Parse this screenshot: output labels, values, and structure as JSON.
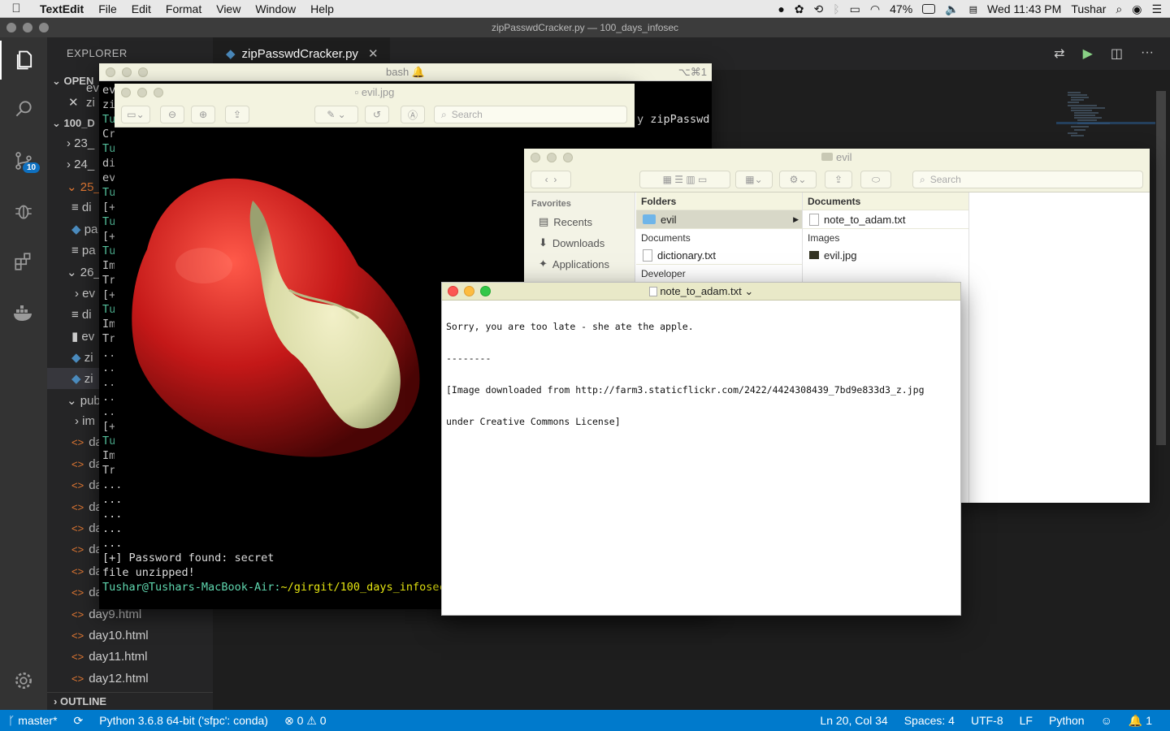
{
  "menubar": {
    "app": "TextEdit",
    "items": [
      "File",
      "Edit",
      "Format",
      "View",
      "Window",
      "Help"
    ],
    "battery": "47%",
    "clock": "Wed 11:43 PM",
    "user": "Tushar"
  },
  "vscode": {
    "window_title": "zipPasswdCracker.py — 100_days_infosec",
    "sidebar_title": "EXPLORER",
    "section_open": "OPEN",
    "section_repo": "100_D",
    "activity_badge": "10",
    "tree": [
      {
        "label": "ev",
        "indent": 1
      },
      {
        "label": "zi",
        "indent": 1
      },
      {
        "label": "23_",
        "indent": 0
      },
      {
        "label": "24_",
        "indent": 0
      },
      {
        "label": "25_",
        "indent": 0
      },
      {
        "label": "di",
        "indent": 1
      },
      {
        "label": "pa",
        "indent": 1
      },
      {
        "label": "pa",
        "indent": 1
      },
      {
        "label": "26_",
        "indent": 0
      },
      {
        "label": "ev",
        "indent": 1
      },
      {
        "label": "di",
        "indent": 1
      },
      {
        "label": "ev",
        "indent": 1
      },
      {
        "label": "zi",
        "indent": 1
      },
      {
        "label": "zi",
        "indent": 1
      },
      {
        "label": "pub",
        "indent": 0
      },
      {
        "label": "im",
        "indent": 1
      },
      {
        "label": "da",
        "indent": 1
      },
      {
        "label": "da",
        "indent": 1
      },
      {
        "label": "da",
        "indent": 1
      },
      {
        "label": "da",
        "indent": 1
      },
      {
        "label": "da",
        "indent": 1
      },
      {
        "label": "da",
        "indent": 1
      },
      {
        "label": "da",
        "indent": 1
      },
      {
        "label": "da",
        "indent": 1
      },
      {
        "label": "day9.html",
        "indent": 1
      },
      {
        "label": "day10.html",
        "indent": 1
      },
      {
        "label": "day11.html",
        "indent": 1
      },
      {
        "label": "day12.html",
        "indent": 1
      }
    ],
    "outline_label": "OUTLINE",
    "active_tab": "zipPasswdCracker.py",
    "status": {
      "branch": "master*",
      "python": "Python 3.6.8 64-bit ('sfpc': conda)",
      "errors": "0",
      "warnings": "0",
      "position": "Ln 20, Col 34",
      "spaces": "Spaces: 4",
      "encoding": "UTF-8",
      "eol": "LF",
      "language": "Python",
      "notifications": "1"
    }
  },
  "bash": {
    "title": "bash",
    "shortcut": "⌥⌘1",
    "visible_fragment": "y zipPasswd",
    "left_fragments": [
      "ev",
      "zi",
      "Tu",
      "Cr",
      "Tu",
      "di",
      "ev",
      "Tu",
      "[+",
      "Tu",
      "[+",
      "Tu",
      "Im",
      "Tr",
      "[+",
      "Tu",
      "Im",
      "Tr",
      "..",
      "..",
      "..",
      "..",
      "..",
      "[+",
      "Tu",
      "Im",
      "Tr"
    ],
    "bottom_dots": [
      "...",
      "...",
      "...",
      "...",
      "..."
    ],
    "found_line": "[+] Password found: secret",
    "unzipped_line": "file unzipped!",
    "prompt_user": "Tushar",
    "prompt_host": "@Tushars-MacBook-Air:",
    "prompt_path": "~/girgit/100_days_infosec"
  },
  "preview": {
    "title": "evil.jpg",
    "search_placeholder": "Search"
  },
  "finder": {
    "title": "evil",
    "search_placeholder": "Search",
    "favorites_label": "Favorites",
    "favorites": [
      "Recents",
      "Downloads",
      "Applications"
    ],
    "col1_header": "Folders",
    "col1_items": [
      "evil"
    ],
    "col1_sub1": "Documents",
    "col1_sub1_items": [
      "dictionary.txt"
    ],
    "col1_sub2": "Developer",
    "col2_header": "Documents",
    "col2_items": [
      "note_to_adam.txt"
    ],
    "col2_sub": "Images",
    "col2_sub_items": [
      "evil.jpg"
    ]
  },
  "textedit": {
    "title": "note_to_adam.txt",
    "lines": [
      "Sorry, you are too late - she ate the apple.",
      "--------",
      "[Image downloaded from http://farm3.staticflickr.com/2422/4424308439_7bd9e833d3_z.jpg",
      "under Creative Commons License]"
    ]
  },
  "colors": {
    "vscode_status": "#007acc",
    "terminal_green": "#5fd7af",
    "terminal_yellow": "#e5e510",
    "close_red": "#fc5753",
    "min_yellow": "#fdbc40",
    "max_green": "#33c748"
  }
}
